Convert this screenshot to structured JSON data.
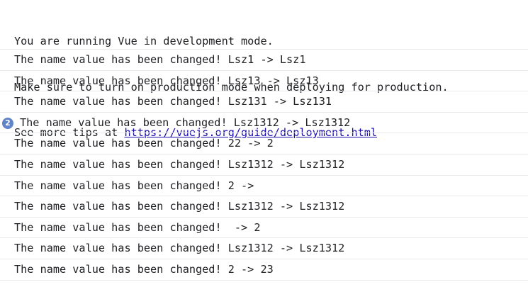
{
  "warning": {
    "line1": "You are running Vue in development mode.",
    "line2": "Make sure to turn on production mode when deploying for production.",
    "line3_prefix": "See more tips at ",
    "line3_link": "https://vuejs.org/guide/deployment.html"
  },
  "messages": [
    {
      "text": "The name value has been changed! Lsz1 -> Lsz1"
    },
    {
      "text": "The name value has been changed! Lsz13 -> Lsz13"
    },
    {
      "text": "The name value has been changed! Lsz131 -> Lsz131"
    },
    {
      "text": "The name value has been changed! Lsz1312 -> Lsz1312",
      "repeat_count": "2"
    },
    {
      "text": "The name value has been changed! 22 -> 2"
    },
    {
      "text": "The name value has been changed! Lsz1312 -> Lsz1312"
    },
    {
      "text": "The name value has been changed! 2 -> "
    },
    {
      "text": "The name value has been changed! Lsz1312 -> Lsz1312"
    },
    {
      "text": "The name value has been changed!  -> 2"
    },
    {
      "text": "The name value has been changed! Lsz1312 -> Lsz1312"
    },
    {
      "text": "The name value has been changed! 2 -> 23"
    }
  ],
  "colors": {
    "badge": "#5f84c9",
    "link": "#1a0dab",
    "separator": "#e8eaed",
    "text": "#202124"
  }
}
